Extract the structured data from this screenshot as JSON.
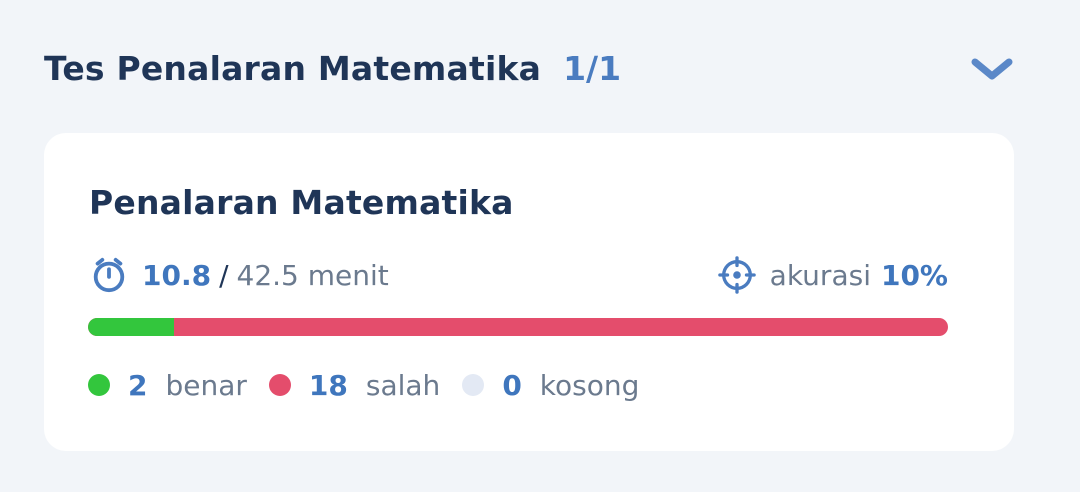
{
  "section": {
    "title": "Tes Penalaran Matematika",
    "count": "1/1",
    "collapse_icon": "chevron-down-icon"
  },
  "card": {
    "title": "Penalaran Matematika",
    "time": {
      "icon": "stopwatch-icon",
      "used": "10.8",
      "separator": "/",
      "total": "42.5 menit"
    },
    "accuracy": {
      "icon": "target-icon",
      "label": "akurasi",
      "value": "10%"
    },
    "progress": {
      "correct_fraction": 0.1,
      "colors": {
        "correct": "#33c63d",
        "wrong": "#e44d6c"
      }
    },
    "legend": [
      {
        "count": "2",
        "label": "benar",
        "color": "#33c63d"
      },
      {
        "count": "18",
        "label": "salah",
        "color": "#e44d6c"
      },
      {
        "count": "0",
        "label": "kosong",
        "color": "#e3e9f4"
      }
    ]
  }
}
